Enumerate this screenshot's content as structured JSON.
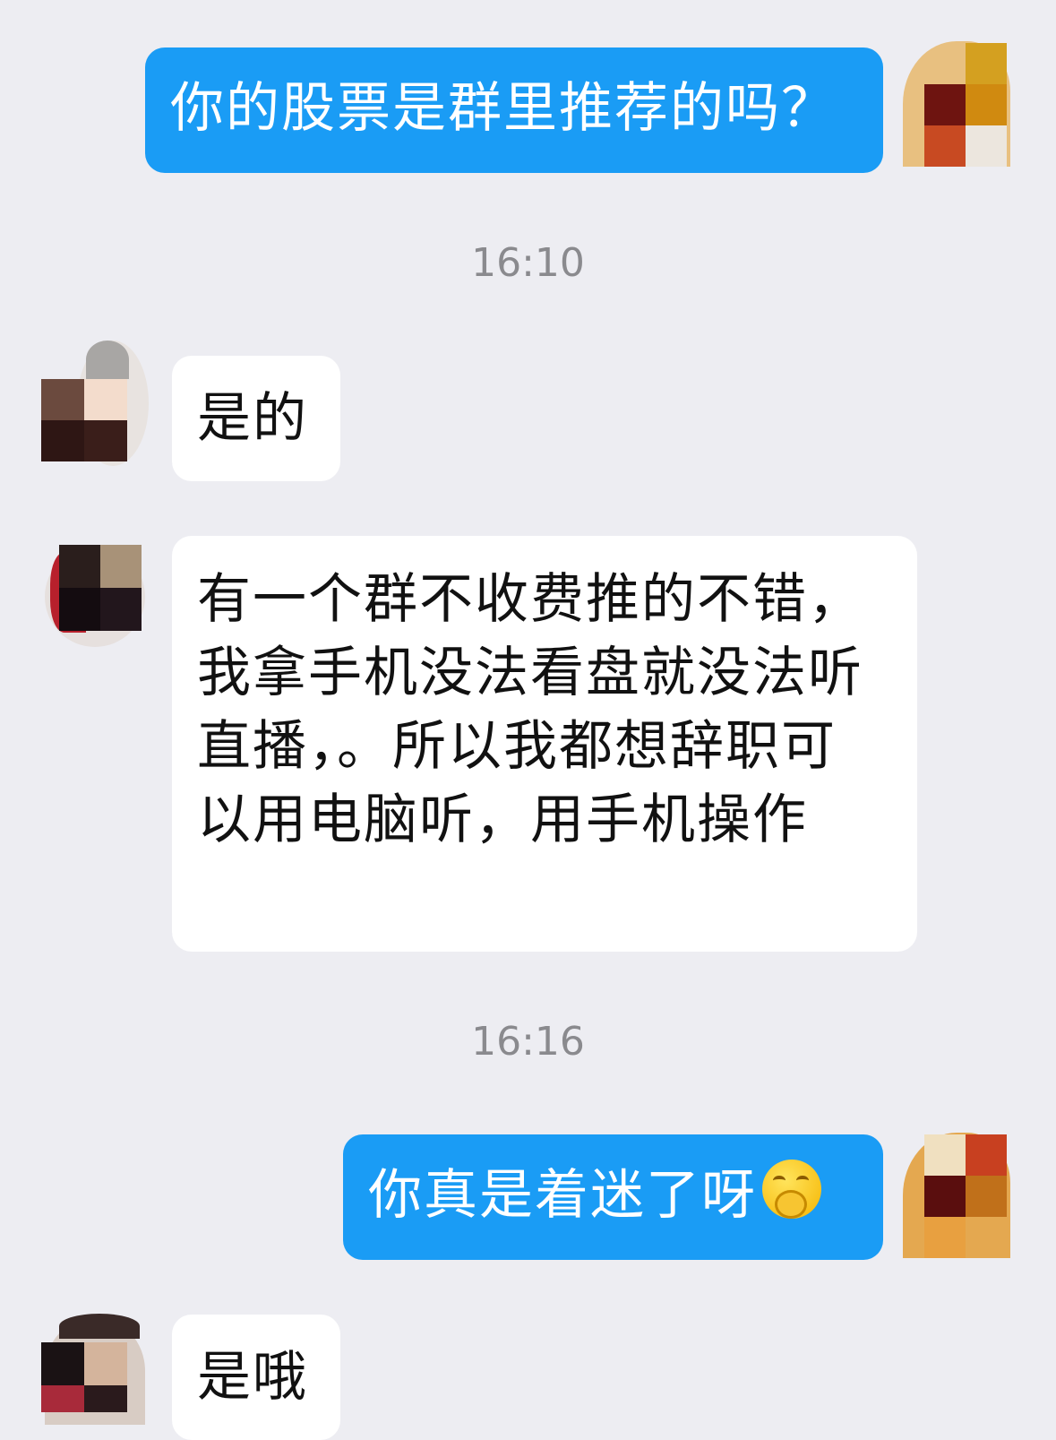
{
  "messages": [
    {
      "direction": "outgoing",
      "text": "你的股票是群里推荐的吗？"
    },
    {
      "timestamp": "16:10"
    },
    {
      "direction": "incoming",
      "text": "是的"
    },
    {
      "direction": "incoming",
      "text": "有一个群不收费推的不错，我拿手机没法看盘就没法听直播，。所以我都想辞职可以用电脑听，用手机操作"
    },
    {
      "timestamp": "16:16"
    },
    {
      "direction": "outgoing",
      "text": "你真是着迷了呀",
      "emoji": "hand-over-mouth-smile-emoji"
    },
    {
      "direction": "incoming",
      "text": "是哦"
    }
  ],
  "colors": {
    "background": "#ededf2",
    "outgoing_bubble": "#1a9cf5",
    "incoming_bubble": "#ffffff"
  }
}
